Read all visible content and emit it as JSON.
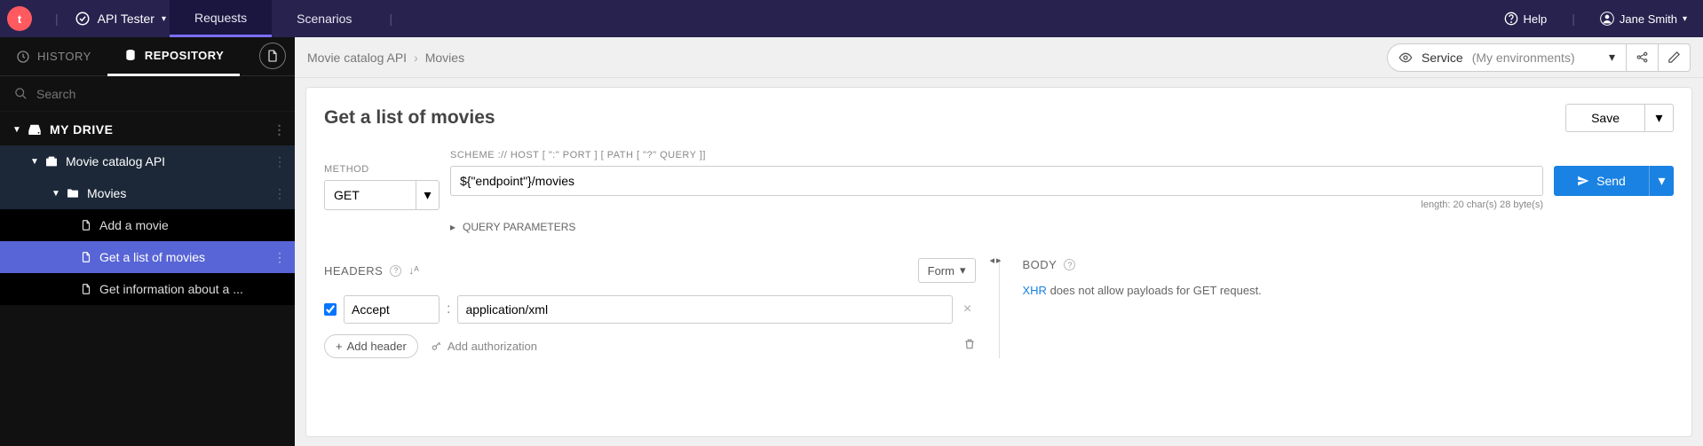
{
  "topbar": {
    "brand": "API Tester",
    "tabs": {
      "requests": "Requests",
      "scenarios": "Scenarios"
    },
    "help": "Help",
    "user": "Jane Smith"
  },
  "sidebar": {
    "tabs": {
      "history": "HISTORY",
      "repository": "REPOSITORY"
    },
    "search_placeholder": "Search",
    "drive_label": "MY DRIVE",
    "project": "Movie catalog API",
    "folder": "Movies",
    "items": [
      "Add a movie",
      "Get a list of movies",
      "Get information about a ..."
    ]
  },
  "breadcrumb": {
    "a": "Movie catalog API",
    "b": "Movies"
  },
  "env": {
    "label": "Service",
    "context": "(My environments)"
  },
  "request": {
    "title": "Get a list of movies",
    "save": "Save",
    "method_label": "METHOD",
    "method": "GET",
    "url_label": "SCHEME :// HOST [ \":\" PORT ] [ PATH [ \"?\" QUERY ]]",
    "url": "${\"endpoint\"}/movies",
    "send": "Send",
    "length_info": "length: 20 char(s) 28 byte(s)",
    "query_params": "QUERY PARAMETERS"
  },
  "headers": {
    "label": "HEADERS",
    "form": "Form",
    "row": {
      "name": "Accept",
      "value": "application/xml"
    },
    "add_header": "Add header",
    "add_auth": "Add authorization"
  },
  "body": {
    "label": "BODY",
    "xhr": "XHR",
    "msg": " does not allow payloads for GET request."
  }
}
